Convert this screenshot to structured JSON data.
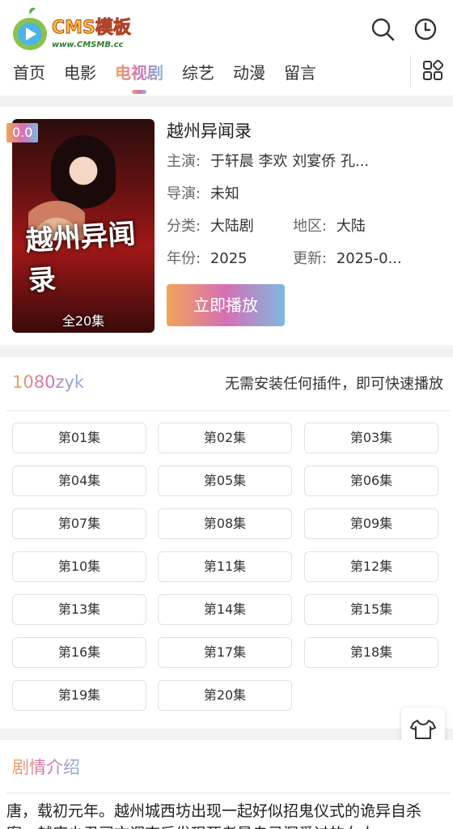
{
  "header": {
    "logo_text": "CMS模板",
    "logo_sub": "www.CMSMB.cc"
  },
  "nav": {
    "items": [
      {
        "label": "首页"
      },
      {
        "label": "电影"
      },
      {
        "label": "电视剧",
        "active": true
      },
      {
        "label": "综艺"
      },
      {
        "label": "动漫"
      },
      {
        "label": "留言"
      }
    ]
  },
  "video": {
    "score": "0.0",
    "title": "越州异闻录",
    "poster_title": "越州异闻录",
    "episodes_badge": "全20集",
    "actors_label": "主演:",
    "actors": "于轩晨  李欢  刘宴侨  孔...",
    "director_label": "导演:",
    "director": "未知",
    "category_label": "分类:",
    "category": "大陆剧",
    "region_label": "地区:",
    "region": "大陆",
    "year_label": "年份:",
    "year": "2025",
    "updated_label": "更新:",
    "updated": "2025-0...",
    "play_label": "立即播放"
  },
  "source": {
    "name": "1080zyk",
    "tip": "无需安装任何插件，即可快速播放"
  },
  "episodes": [
    "第01集",
    "第02集",
    "第03集",
    "第04集",
    "第05集",
    "第06集",
    "第07集",
    "第08集",
    "第09集",
    "第10集",
    "第11集",
    "第12集",
    "第13集",
    "第14集",
    "第15集",
    "第16集",
    "第17集",
    "第18集",
    "第19集",
    "第20集"
  ],
  "synopsis": {
    "title": "剧情介绍",
    "text": "唐，载初元年。越州城西坊出现一起好似招鬼仪式的诡异自杀案，越府少尹司文调查后发现死者是自己深爱过的女人"
  },
  "colors": {
    "accent_gradient": [
      "#f2a35a",
      "#d66fb5",
      "#7fb8e0"
    ]
  }
}
